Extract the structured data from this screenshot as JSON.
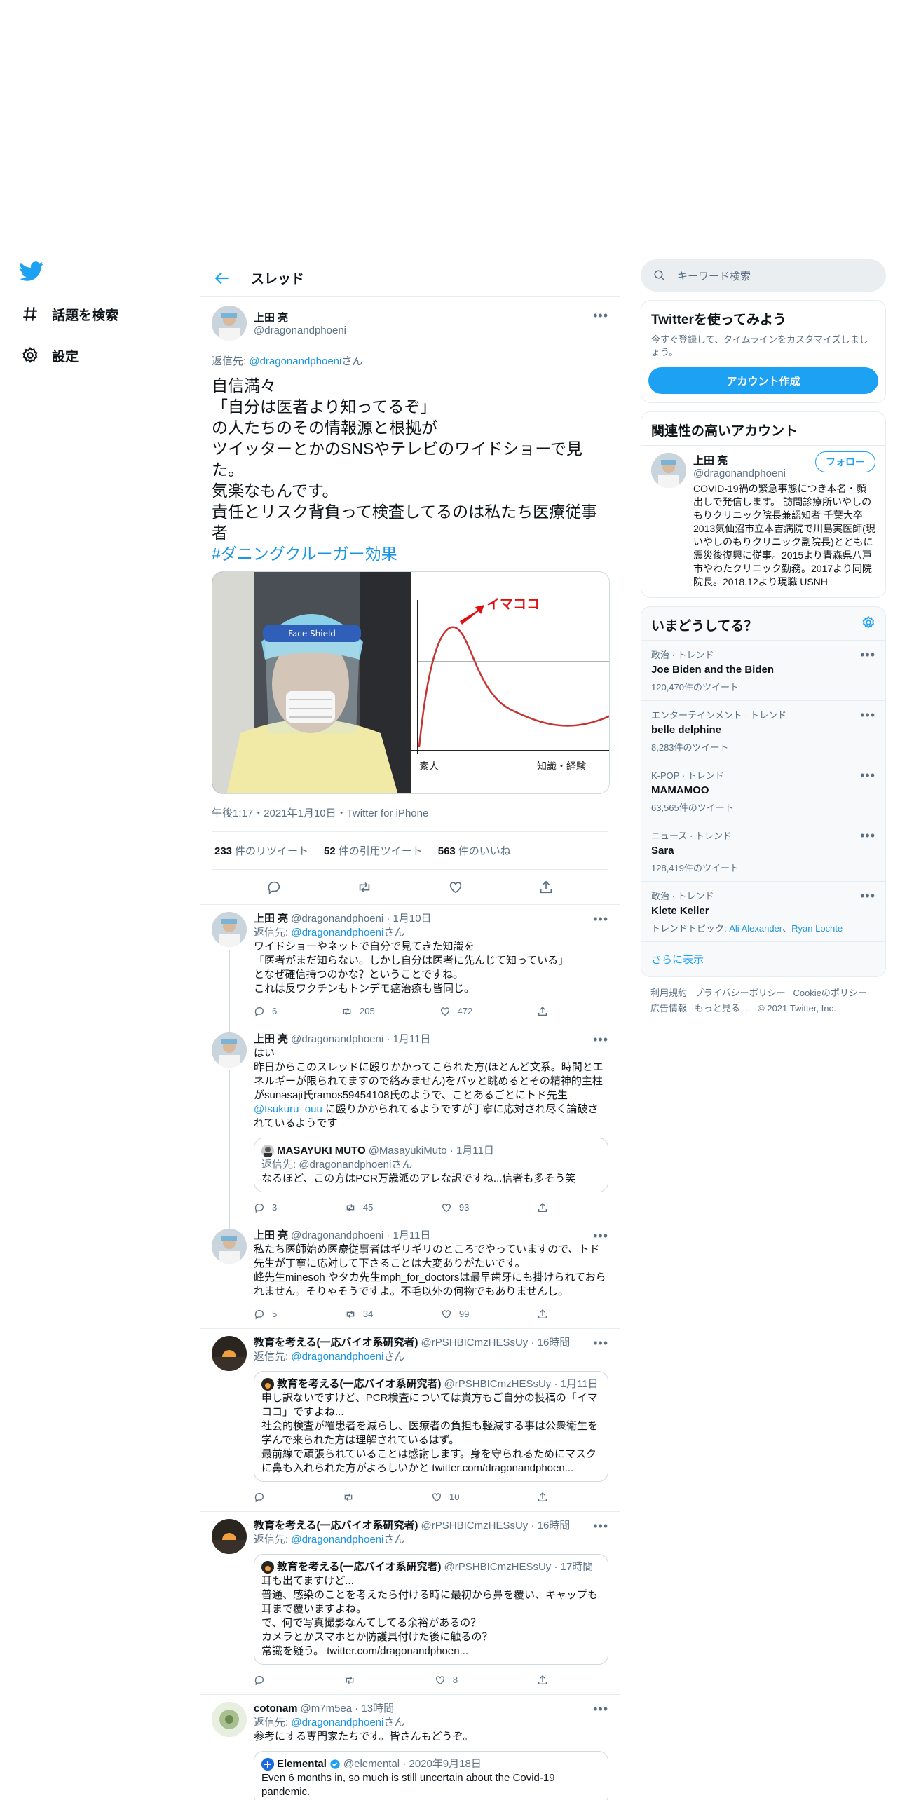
{
  "nav": {
    "items": [
      {
        "label": "話題を検索",
        "icon": "hashtag-icon"
      },
      {
        "label": "設定",
        "icon": "gear-icon"
      }
    ]
  },
  "header": {
    "title": "スレッド"
  },
  "focus": {
    "name": "上田 亮",
    "handle": "@dragonandphoeni",
    "reply_prefix": "返信先: ",
    "reply_to": "@dragonandphoeni",
    "reply_suffix": "さん",
    "text": "自信満々\n「自分は医者より知ってるぞ」\nの人たちのその情報源と根拠が\nツイッターとかのSNSやテレビのワイドショーで見た。\n気楽なもんです。\n責任とリスク背負って検査してるのは私たち医療従事者",
    "hashtag": "#ダニングクルーガー効果",
    "media": {
      "annotation": "イマココ",
      "xlabel_left": "素人",
      "xlabel_right": "知識・経験",
      "shield_text": "Face Shield"
    },
    "meta": "午後1:17・2021年1月10日・Twitter for iPhone",
    "stats": [
      {
        "count": "233",
        "label": "件のリツイート"
      },
      {
        "count": "52",
        "label": "件の引用ツイート"
      },
      {
        "count": "563",
        "label": "件のいいね"
      }
    ]
  },
  "replies": [
    {
      "name": "上田 亮",
      "handle": "@dragonandphoeni · 1月10日",
      "reply_to": "@dragonandphoeni",
      "text": "ワイドショーやネットで自分で見てきた知識を\n「医者がまだ知らない。しかし自分は医者に先んじて知っている」\nとなぜ確信持つのかな？ということですね。\nこれは反ワクチンもトンデモ癌治療も皆同じ。",
      "counts": {
        "reply": "6",
        "retweet": "205",
        "like": "472"
      }
    },
    {
      "name": "上田 亮",
      "handle": "@dragonandphoeni · 1月11日",
      "text1": "はい\n昨日からこのスレッドに殴りかかってこられた方(ほとんど文系。時間とエネルギーが限られてますので絡みません)をパッと眺めるとその精神的主柱がsunasaji氏ramos59454108氏のようで、ことあるごとにトド先生",
      "mention": "@tsukuru_ouu",
      "text2": " に殴りかかられてるようですが丁寧に応対され尽く論破されているようです",
      "quote": {
        "name": "MASAYUKI MUTO",
        "handle": "@MasayukiMuto · 1月11日",
        "reply": "返信先: @dragonandphoeniさん",
        "text": "なるほど、この方はPCR万歳派のアレな訳ですね...信者も多そう笑"
      },
      "counts": {
        "reply": "3",
        "retweet": "45",
        "like": "93"
      }
    },
    {
      "name": "上田 亮",
      "handle": "@dragonandphoeni · 1月11日",
      "text": "私たち医師始め医療従事者はギリギリのところでやっていますので、トド先生が丁寧に応対して下さることは大変ありがたいです。\n峰先生minesoh やタカ先生mph_for_doctorsは最早歯牙にも掛けられておられません。そりゃそうですよ。不毛以外の何物でもありませんし。",
      "counts": {
        "reply": "5",
        "retweet": "34",
        "like": "99"
      }
    },
    {
      "name": "教育を考える(一応バイオ系研究者)",
      "handle": "@rPSHBICmzHESsUy · 16時間",
      "reply_to": "@dragonandphoeni",
      "quote": {
        "name": "教育を考える(一応バイオ系研究者)",
        "handle": "@rPSHBICmzHESsUy · 1月11日",
        "text": "申し訳ないですけど、PCR検査については貴方もご自分の投稿の「イマココ」ですよね...\n社会的検査が罹患者を減らし、医療者の負担も軽減する事は公衆衛生を学んで来られた方は理解されているはず。\n最前線で頑張られていることは感謝します。身を守られるためにマスクに鼻も入れられた方がよろしいかと twitter.com/dragonandphoen..."
      },
      "counts": {
        "like": "10"
      }
    },
    {
      "name": "教育を考える(一応バイオ系研究者)",
      "handle": "@rPSHBICmzHESsUy · 16時間",
      "reply_to": "@dragonandphoeni",
      "quote": {
        "name": "教育を考える(一応バイオ系研究者)",
        "handle": "@rPSHBICmzHESsUy · 17時間",
        "text": "耳も出てますけど...\n普通、感染のことを考えたら付ける時に最初から鼻を覆い、キャップも耳まで覆いますよね。\nで、何で写真撮影なんてしてる余裕があるの？\nカメラとかスマホとか防護具付けた後に触るの？\n常識を疑う。 twitter.com/dragonandphoen..."
      },
      "counts": {
        "like": "8"
      }
    },
    {
      "name": "cotonam",
      "handle": "@m7m5ea · 13時間",
      "reply_to": "@dragonandphoeni",
      "text": "参考にする専門家たちです。皆さんもどうぞ。",
      "quote": {
        "name": "Elemental",
        "handle": "@elemental · 2020年9月18日",
        "text": "Even 6 months in, so much is still uncertain about the Covid-19 pandemic."
      }
    }
  ],
  "sidebar": {
    "search_placeholder": "キーワード検索",
    "signup": {
      "title": "Twitterを使ってみよう",
      "desc": "今すぐ登録して、タイムラインをカスタマイズしましょう。",
      "button": "アカウント作成"
    },
    "relevant": {
      "title": "関連性の高いアカウント",
      "name": "上田 亮",
      "handle": "@dragonandphoeni",
      "follow": "フォロー",
      "bio": "COVID-19禍の緊急事態につき本名・顔出しで発信します。 訪問診療所いやしのもりクリニック院長兼認知者 千葉大卒 2013気仙沼市立本吉病院で川島実医師(現いやしのもりクリニック副院長)とともに震災後復興に従事。2015より青森県八戸市やわたクリニック勤務。2017より同院院長。2018.12より現職 USNH"
    },
    "trends": {
      "title": "いまどうしてる？",
      "items": [
        {
          "cat": "政治 · トレンド",
          "name": "Joe Biden and the Biden",
          "count": "120,470件のツイート"
        },
        {
          "cat": "エンターテインメント · トレンド",
          "name": "belle delphine",
          "count": "8,283件のツイート"
        },
        {
          "cat": "K-POP · トレンド",
          "name": "MAMAMOO",
          "count": "63,565件のツイート"
        },
        {
          "cat": "ニュース · トレンド",
          "name": "Sara",
          "count": "128,419件のツイート"
        },
        {
          "cat": "政治 · トレンド",
          "name": "Klete Keller",
          "topic_prefix": "トレンドトピック: ",
          "topic1": "Ali Alexander",
          "topic2": "Ryan Lochte"
        }
      ],
      "show_more": "さらに表示"
    },
    "footer": {
      "links": [
        "利用規約",
        "プライバシーポリシー",
        "Cookieのポリシー",
        "広告情報",
        "もっと見る ..."
      ],
      "copyright": "© 2021 Twitter, Inc."
    }
  }
}
